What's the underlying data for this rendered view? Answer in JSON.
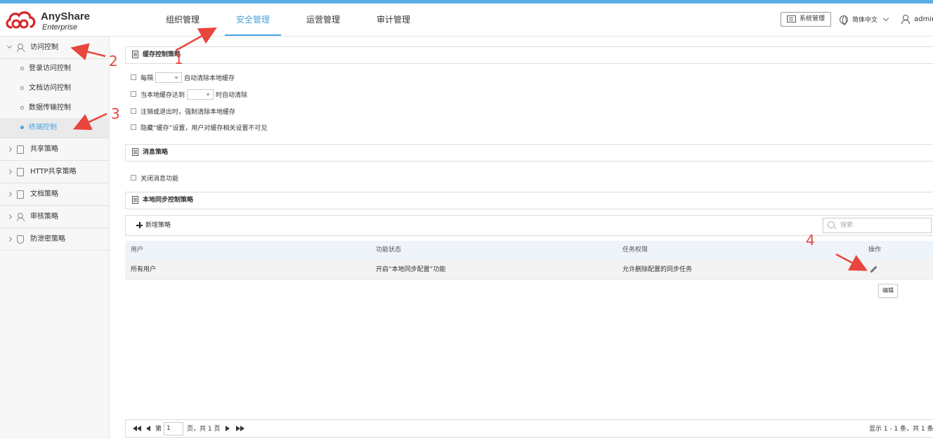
{
  "app": {
    "brand": "AnyShare",
    "edition": "Enterprise"
  },
  "nav": {
    "tabs": [
      {
        "label": "组织管理",
        "active": false
      },
      {
        "label": "安全管理",
        "active": true
      },
      {
        "label": "运营管理",
        "active": false
      },
      {
        "label": "审计管理",
        "active": false
      }
    ],
    "system_button": "系统管理",
    "language": "简体中文",
    "user": "admin"
  },
  "sidebar": {
    "access_control": "访问控制",
    "sub_items": [
      "登录访问控制",
      "文档访问控制",
      "数据传输控制",
      "终端控制"
    ],
    "active_sub": "终端控制",
    "items": [
      "共享策略",
      "HTTP共享策略",
      "文档策略",
      "审核策略",
      "防泄密策略"
    ]
  },
  "cache_policy": {
    "title": "缓存控制策略",
    "opt1_pre": "每隔",
    "opt1_post": "自动清除本地缓存",
    "opt2_pre": "当本地缓存达到",
    "opt2_post": "时自动清除",
    "opt3": "注销或退出时，强制清除本地缓存",
    "opt4": "隐藏“缓存”设置，用户对缓存相关设置不可见"
  },
  "message_policy": {
    "title": "消息策略",
    "opt1": "关闭消息功能"
  },
  "sync_policy": {
    "title": "本地同步控制策略",
    "add_label": "新增策略",
    "search_placeholder": "搜索",
    "columns": [
      "用户",
      "功能状态",
      "任务权限",
      "操作"
    ],
    "row": {
      "user": "所有用户",
      "status": "开启“本地同步配置”功能",
      "permission": "允许删除配置的同步任务"
    },
    "edit_tooltip": "编辑"
  },
  "pager": {
    "page_prefix": "第",
    "page_value": "1",
    "page_suffix": "页，共 1 页",
    "summary": "显示 1 - 1 条，共 1 条"
  },
  "annotations": [
    "1",
    "2",
    "3",
    "4"
  ],
  "colors": {
    "accent": "#4aa3df",
    "annotation": "#e8453c",
    "logo": "#d9252a"
  }
}
